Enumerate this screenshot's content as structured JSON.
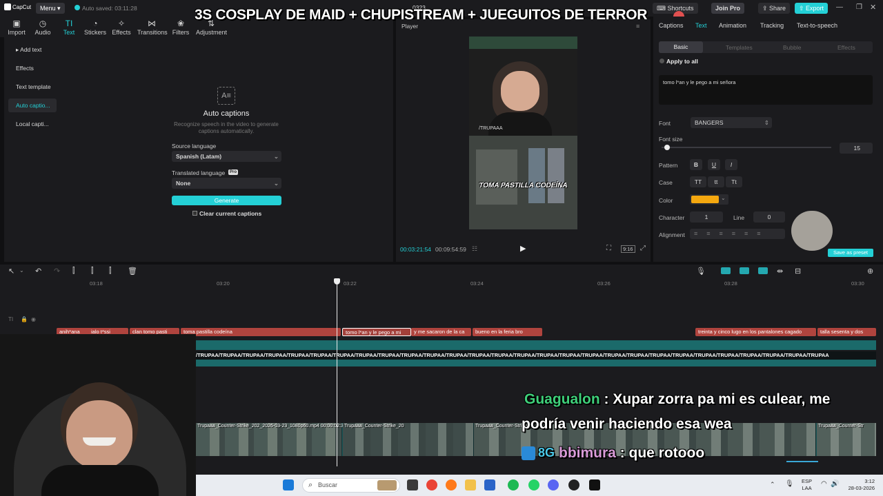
{
  "titlebar": {
    "app_name": "CapCut",
    "menu_label": "Menu",
    "autosave": "Auto saved: 03:11:28",
    "project_name": "0323",
    "shortcuts_label": "Shortcuts",
    "join_pro_label": "Join Pro",
    "share_label": "Share",
    "export_label": "Export"
  },
  "stream_banner": "3S COSPLAY DE MAID + CHUPISTREAM + JUEGUITOS DE TERROR",
  "toolbar": {
    "tools": [
      {
        "label": "Import",
        "icon": "import-icon"
      },
      {
        "label": "Audio",
        "icon": "audio-icon"
      },
      {
        "label": "Text",
        "icon": "text-icon"
      },
      {
        "label": "Stickers",
        "icon": "stickers-icon"
      },
      {
        "label": "Effects",
        "icon": "effects-icon"
      },
      {
        "label": "Transitions",
        "icon": "transitions-icon"
      },
      {
        "label": "Filters",
        "icon": "filters-icon"
      },
      {
        "label": "Adjustment",
        "icon": "adjustment-icon"
      }
    ],
    "active_tool": "Text"
  },
  "left_nav": {
    "items": [
      "▸ Add text",
      "Effects",
      "Text template",
      "Auto captio...",
      "Local capti..."
    ],
    "active_index": 3
  },
  "auto_captions": {
    "title": "Auto captions",
    "description": "Recognize speech in the video to generate captions automatically.",
    "source_language_label": "Source language",
    "source_language_value": "Spanish (Latam)",
    "translated_language_label": "Translated language",
    "pro_badge": "Pro",
    "translated_language_value": "None",
    "generate_label": "Generate",
    "clear_label": "Clear current captions"
  },
  "player": {
    "title": "Player",
    "current_time": "00:03:21:54",
    "total_time": "00:09:54:59",
    "ratio_label": "9:16",
    "watermark_text": "/TRUPAAA",
    "caption_in_video": "TOMA PASTILLA CODEÍNA"
  },
  "right_panel": {
    "tabs": [
      "Captions",
      "Text",
      "Animation",
      "Tracking",
      "Text-to-speech"
    ],
    "active_tab": "Text",
    "subtabs": [
      "Basic",
      "Templates",
      "Bubble",
      "Effects"
    ],
    "active_subtab": "Basic",
    "apply_to_all": "Apply to all",
    "text_value": "tomo l*an y le pego a mi señora",
    "font_label": "Font",
    "font_value": "BANGERS",
    "font_size_label": "Font size",
    "font_size_value": "15",
    "pattern_label": "Pattern",
    "pattern_buttons": [
      "B",
      "U",
      "I"
    ],
    "case_label": "Case",
    "case_buttons": [
      "TT",
      "tt",
      "Tt"
    ],
    "color_label": "Color",
    "color_value": "#f5a80f",
    "character_label": "Character",
    "character_value": "1",
    "line_label": "Line",
    "line_value": "0",
    "alignment_label": "Alignment",
    "save_preset_label": "Save as preset",
    "multiplier_text": "x2"
  },
  "timeline": {
    "ruler_labels": [
      "03:18",
      "03:20",
      "03:22",
      "03:24",
      "03:26",
      "03:28",
      "03:30"
    ],
    "text_clips": [
      "anih*ana",
      "ialo t*ssi",
      "clan tomo pasti",
      "toma pastilla codeína",
      "tomo l*an y le pego a mi",
      "y me sacaron de la ca",
      "bueno en la feria bro",
      "treinta y cinco lugo en los pantalones cagado",
      "talla sesenta y dos"
    ],
    "watermark_track_text": "/TRUPAA/TRUPAA/TRUPAA/TRUPAA/TRUPAA/TRUPAA/TRUPAA/TRUPAA/TRUPAA/TRUPAA/TRUPAA/TRUPAA/TRUPAA/TRUPAA/TRUPAA/TRUPAA/TRUPAA/TRUPAA/TRUPAA/TRUPAA/TRUPAA/TRUPAA/TRUPAA/TRUPAA/TRUPAA/TRUPAA/TRUPAA/TRUPAA",
    "video_clips": [
      "Trupaaa_Counter-Strike_202_2026-03-23_1080p60.mp4  00:00:02:33",
      "Trupaaa_Counter-Strike_20",
      "Trupaaa_Counter-Strike_",
      "Trupaaa_Counter-Str"
    ]
  },
  "chat": {
    "line1_user": "Guagualon",
    "line1_text": " : Xupar zorra pa mi es culear, me",
    "line2_text": "podría venir haciendo esa wea",
    "line3_user": "bbimura",
    "line3_text": " : que rotooo",
    "line3_badge": "8G"
  },
  "taskbar": {
    "search_placeholder": "Buscar",
    "lang": "ESP",
    "lang_sub": "LAA",
    "time": "3:12",
    "date": "28-03-2026"
  }
}
